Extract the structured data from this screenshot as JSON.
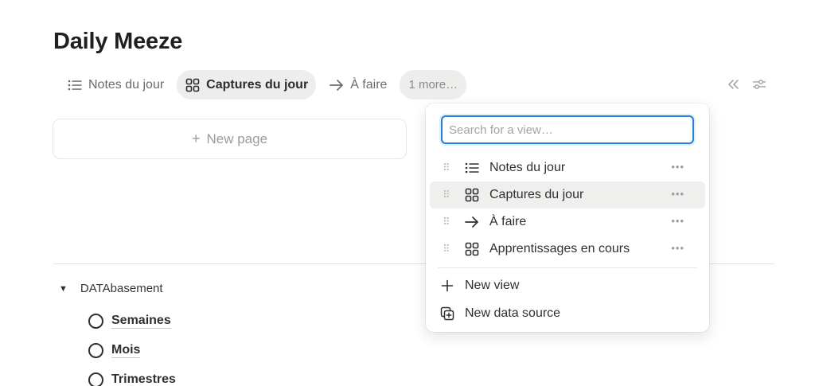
{
  "page": {
    "title": "Daily Meeze",
    "tabs": [
      {
        "label": "Notes du jour",
        "icon": "list-icon"
      },
      {
        "label": "Captures du jour",
        "icon": "gallery-icon"
      },
      {
        "label": "À faire",
        "icon": "arrow-right-icon"
      }
    ],
    "more_label": "1 more…",
    "new_page_label": "New page"
  },
  "dropdown": {
    "search_placeholder": "Search for a view…",
    "views": [
      {
        "label": "Notes du jour",
        "icon": "list-icon",
        "highlighted": false
      },
      {
        "label": "Captures du jour",
        "icon": "gallery-icon",
        "highlighted": true
      },
      {
        "label": "À faire",
        "icon": "arrow-right-icon",
        "highlighted": false
      },
      {
        "label": "Apprentissages en cours",
        "icon": "gallery-icon",
        "highlighted": false
      }
    ],
    "new_view_label": "New view",
    "new_data_source_label": "New data source"
  },
  "database": {
    "toggle_label": "DATAbasement",
    "items": [
      "Semaines",
      "Mois",
      "Trimestres"
    ]
  },
  "colors": {
    "accent": "#2a7fd6",
    "active_tab_bg": "#ededeb",
    "text": "#37352f"
  }
}
